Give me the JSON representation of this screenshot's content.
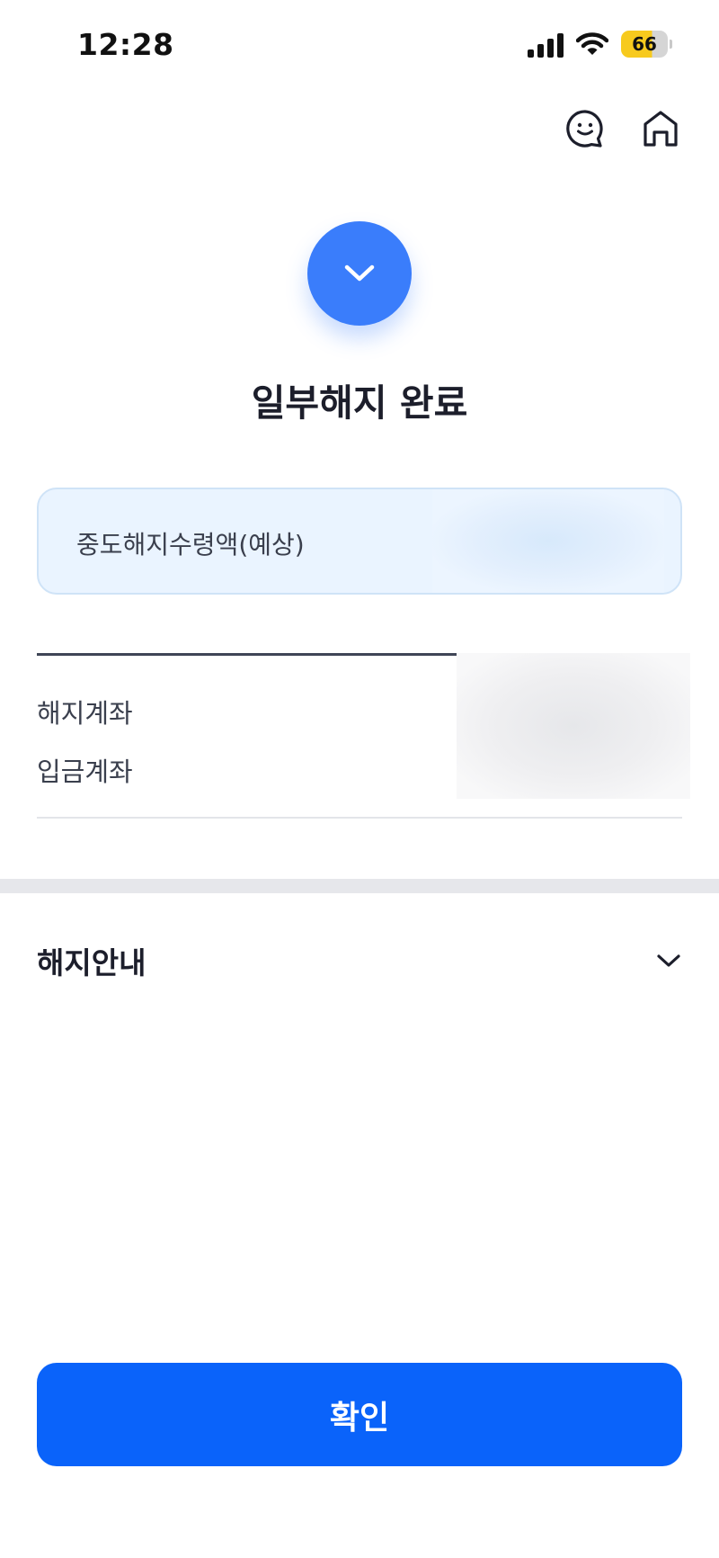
{
  "status_bar": {
    "time": "12:28",
    "battery_level": "66"
  },
  "header": {
    "icons": [
      "chat-smile-icon",
      "home-icon"
    ]
  },
  "result": {
    "title": "일부해지 완료",
    "accent_color": "#3a7dfb"
  },
  "amount_card": {
    "label": "중도해지수령액(예상)"
  },
  "accounts": {
    "rows": [
      {
        "label": "해지계좌"
      },
      {
        "label": "입금계좌"
      }
    ]
  },
  "notice": {
    "title": "해지안내"
  },
  "actions": {
    "confirm_label": "확인",
    "confirm_color": "#0a63fa"
  }
}
